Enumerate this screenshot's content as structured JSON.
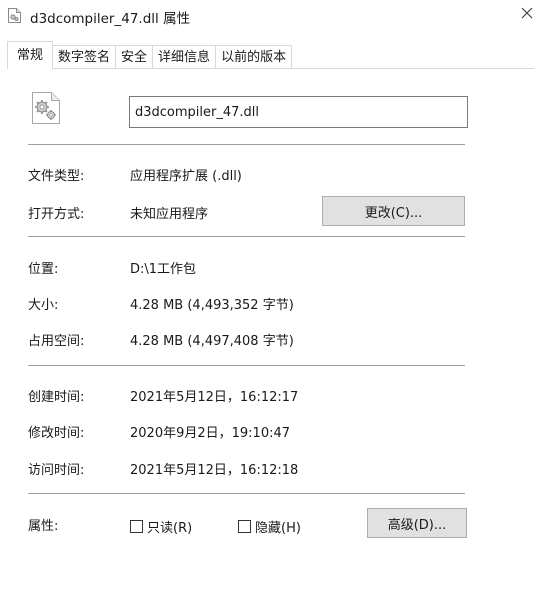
{
  "window": {
    "title": "d3dcompiler_47.dll 属性",
    "close_glyph": "✕"
  },
  "tabs": [
    {
      "label": "常规",
      "active": true
    },
    {
      "label": "数字签名",
      "active": false
    },
    {
      "label": "安全",
      "active": false
    },
    {
      "label": "详细信息",
      "active": false
    },
    {
      "label": "以前的版本",
      "active": false
    }
  ],
  "general": {
    "filename": "d3dcompiler_47.dll",
    "file_type_label": "文件类型:",
    "file_type_value": "应用程序扩展 (.dll)",
    "opens_with_label": "打开方式:",
    "opens_with_value": "未知应用程序",
    "change_button": "更改(C)...",
    "location_label": "位置:",
    "location_value": "D:\\1工作包",
    "size_label": "大小:",
    "size_value": "4.28 MB (4,493,352 字节)",
    "size_on_disk_label": "占用空间:",
    "size_on_disk_value": "4.28 MB (4,497,408 字节)",
    "created_label": "创建时间:",
    "created_value": "2021年5月12日，16:12:17",
    "modified_label": "修改时间:",
    "modified_value": "2020年9月2日，19:10:47",
    "accessed_label": "访问时间:",
    "accessed_value": "2021年5月12日，16:12:18",
    "attributes_label": "属性:",
    "readonly_label": "只读(R)",
    "readonly_checked": false,
    "hidden_label": "隐藏(H)",
    "hidden_checked": false,
    "advanced_button": "高级(D)..."
  },
  "colors": {
    "tab_border": "#d9d9d9",
    "separator": "#a0a0a0",
    "button_bg": "#e1e1e1",
    "button_border": "#adadad",
    "input_border": "#7a7a7a"
  },
  "icons": {
    "title": "dll-file-icon",
    "file": "dll-gear-file-icon",
    "close": "close-icon"
  }
}
